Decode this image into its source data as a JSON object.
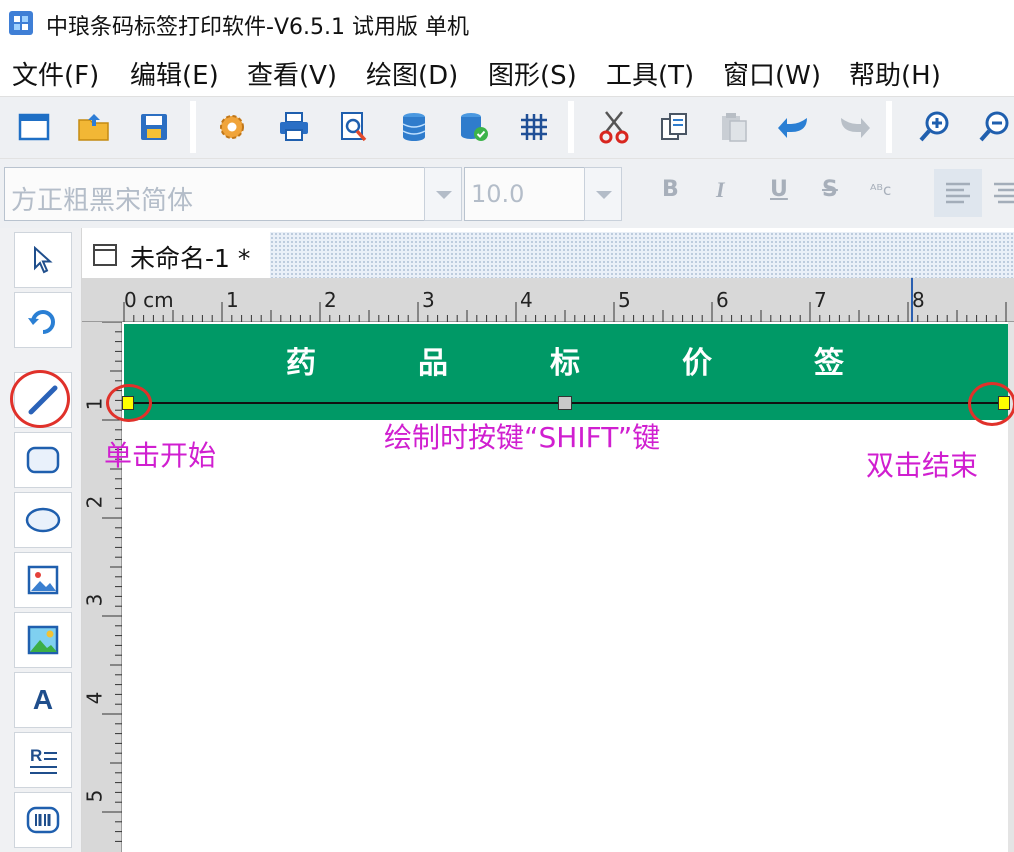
{
  "window": {
    "title": "中琅条码标签打印软件-V6.5.1 试用版 单机"
  },
  "menu": {
    "items": [
      {
        "label": "文件(F)"
      },
      {
        "label": "编辑(E)"
      },
      {
        "label": "查看(V)"
      },
      {
        "label": "绘图(D)"
      },
      {
        "label": "图形(S)"
      },
      {
        "label": "工具(T)"
      },
      {
        "label": "窗口(W)"
      },
      {
        "label": "帮助(H)"
      }
    ]
  },
  "toolbar": {
    "icons": [
      "new-window-icon",
      "open-folder-icon",
      "save-icon",
      "settings-gear-icon",
      "print-icon",
      "print-preview-icon",
      "database-icon",
      "database-check-icon",
      "grid-icon",
      "cut-icon",
      "copy-icon",
      "paste-icon",
      "undo-icon",
      "redo-icon",
      "zoom-in-icon",
      "zoom-out-icon"
    ]
  },
  "format_bar": {
    "font_name": "方正粗黑宋简体",
    "font_size": "10.0",
    "bold": "B",
    "italic": "I",
    "underline": "U",
    "strike": "S",
    "special": "ᴬᴮc"
  },
  "tools": {
    "text_tool": "A",
    "rich_text_tool": "R"
  },
  "document": {
    "tab_label": "未命名-1 *"
  },
  "ruler": {
    "h_labels": [
      "0 cm",
      "1",
      "2",
      "3",
      "4",
      "5",
      "6",
      "7",
      "8"
    ],
    "v_labels": [
      "1",
      "2",
      "3",
      "4",
      "5"
    ]
  },
  "label": {
    "banner_text": [
      "药",
      "品",
      "标",
      "价",
      "签"
    ],
    "banner_color": "#009966"
  },
  "annotations": {
    "start": "单击开始",
    "shift": "绘制时按键“SHIFT”键",
    "end": "双击结束",
    "color": "#d01fd0"
  }
}
